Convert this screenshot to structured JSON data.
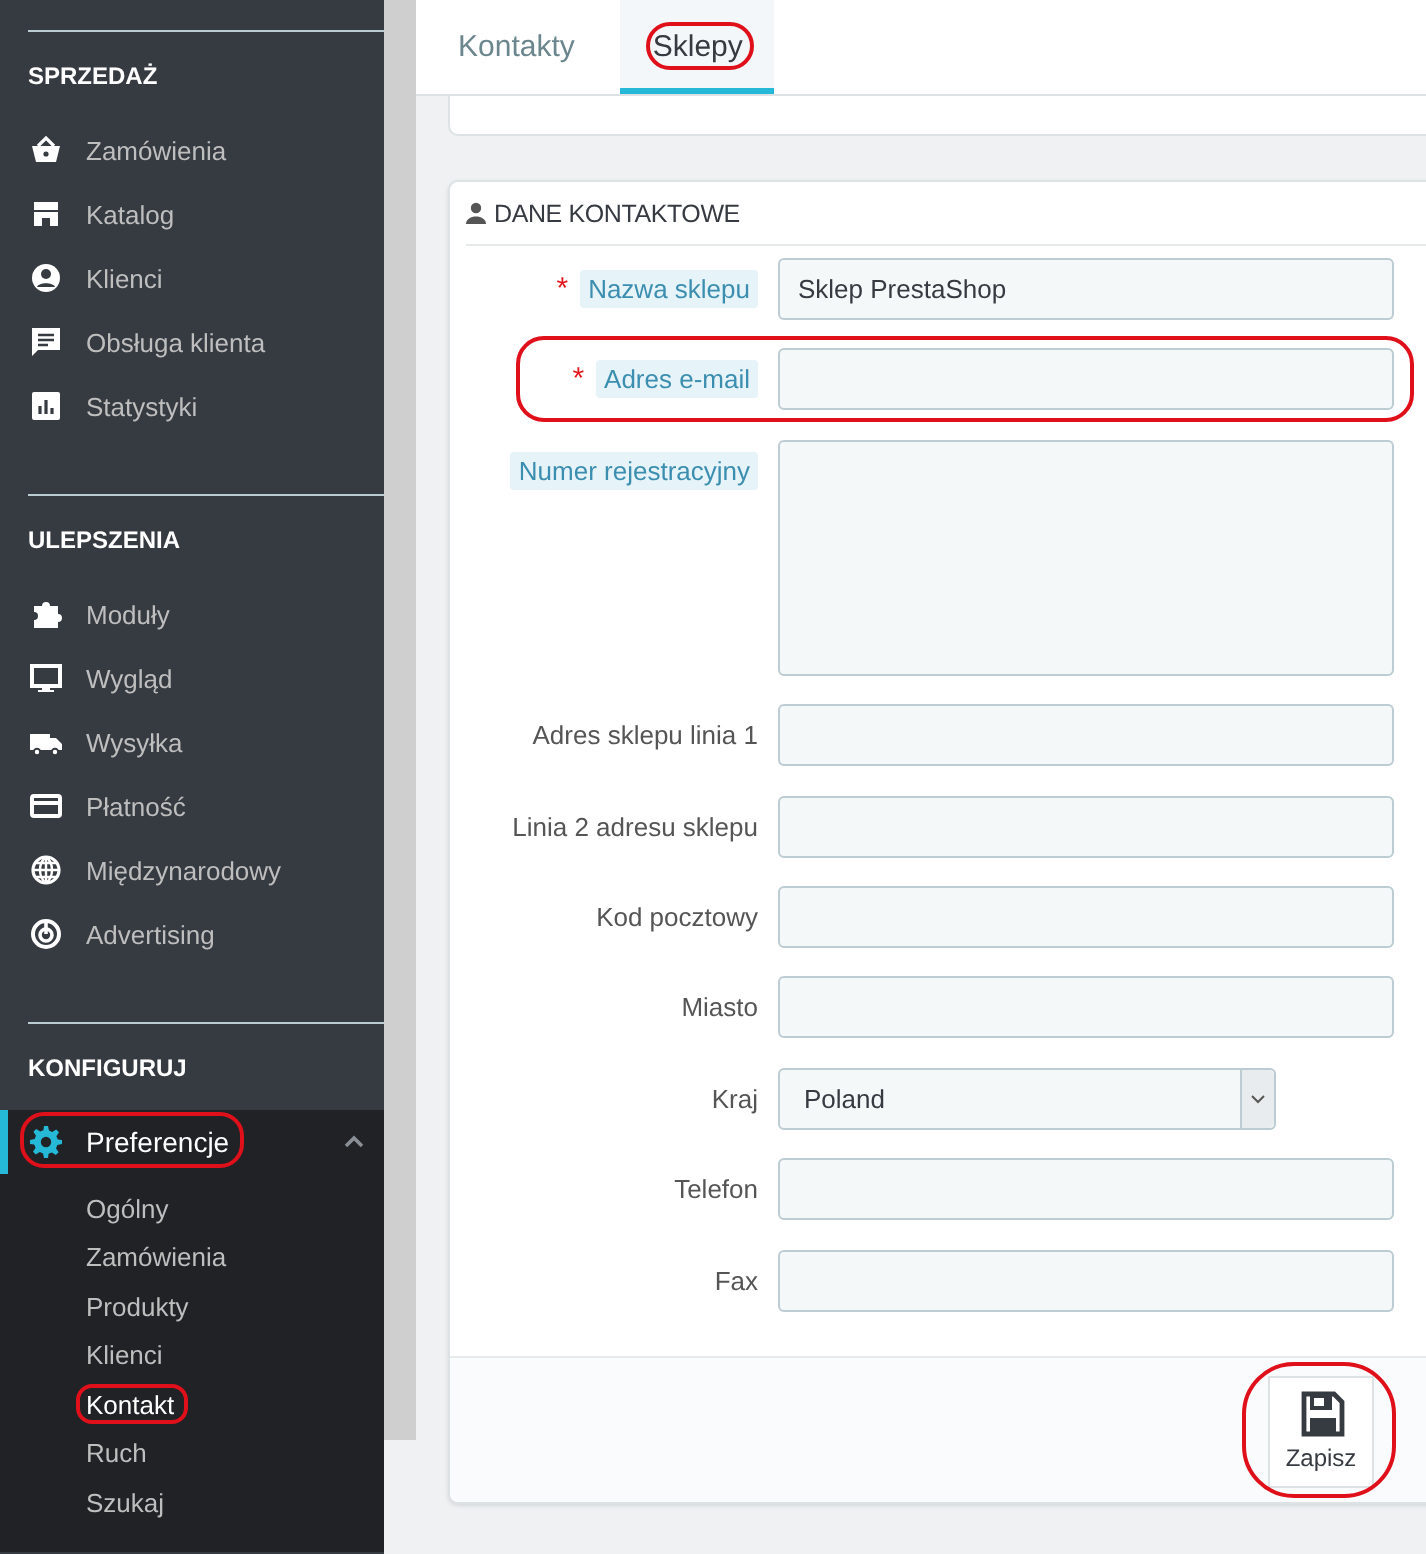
{
  "sidebar": {
    "sections": [
      {
        "title": "SPRZEDAŻ",
        "items": [
          {
            "label": "Zamówienia",
            "kind": "basket"
          },
          {
            "label": "Katalog",
            "kind": "store"
          },
          {
            "label": "Klienci",
            "kind": "person"
          },
          {
            "label": "Obsługa klienta",
            "kind": "chat"
          },
          {
            "label": "Statystyki",
            "kind": "chart"
          }
        ]
      },
      {
        "title": "ULEPSZENIA",
        "items": [
          {
            "label": "Moduły",
            "kind": "puzzle"
          },
          {
            "label": "Wygląd",
            "kind": "monitor"
          },
          {
            "label": "Wysyłka",
            "kind": "truck"
          },
          {
            "label": "Płatność",
            "kind": "card"
          },
          {
            "label": "Międzynarodowy",
            "kind": "globe"
          },
          {
            "label": "Advertising",
            "kind": "target"
          }
        ]
      },
      {
        "title": "KONFIGURUJ",
        "items": [
          {
            "label": "Preferencje",
            "kind": "gear",
            "selected": true,
            "expanded": true,
            "highlighted": true,
            "children": [
              {
                "label": "Ogólny",
                "selected": false,
                "highlighted": false
              },
              {
                "label": "Zamówienia",
                "selected": false,
                "highlighted": false
              },
              {
                "label": "Produkty",
                "selected": false,
                "highlighted": false
              },
              {
                "label": "Klienci",
                "selected": false,
                "highlighted": false
              },
              {
                "label": "Kontakt",
                "selected": true,
                "highlighted": true
              },
              {
                "label": "Ruch",
                "selected": false,
                "highlighted": false
              },
              {
                "label": "Szukaj",
                "selected": false,
                "highlighted": false
              }
            ]
          }
        ]
      }
    ]
  },
  "tabs": [
    {
      "label": "Kontakty",
      "selected": false,
      "highlighted": false
    },
    {
      "label": "Sklepy",
      "selected": true,
      "highlighted": true
    }
  ],
  "form": {
    "title": "DANE KONTAKTOWE",
    "fields": [
      {
        "label": "Nazwa sklepu",
        "kind": "text",
        "marker": "*",
        "hint": true,
        "value": "Sklep PrestaShop",
        "highlighted": false
      },
      {
        "label": "Adres e-mail",
        "kind": "text",
        "marker": "*",
        "hint": true,
        "highlighted": true
      },
      {
        "label": "Numer rejestracyjny",
        "kind": "textarea",
        "hint": true,
        "highlighted": false
      },
      {
        "label": "Adres sklepu linia 1",
        "kind": "text",
        "hint": false,
        "highlighted": false
      },
      {
        "label": "Linia 2 adresu sklepu",
        "kind": "text",
        "hint": false,
        "highlighted": false
      },
      {
        "label": "Kod pocztowy",
        "kind": "text",
        "hint": false,
        "highlighted": false
      },
      {
        "label": "Miasto",
        "kind": "text",
        "hint": false,
        "highlighted": false
      },
      {
        "label": "Kraj",
        "kind": "select",
        "hint": false,
        "value": "Poland",
        "highlighted": false
      },
      {
        "label": "Telefon",
        "kind": "text",
        "hint": false,
        "highlighted": false
      },
      {
        "label": "Fax",
        "kind": "text",
        "hint": false,
        "highlighted": false
      }
    ],
    "save_button": {
      "label": "Zapisz",
      "highlighted": true
    }
  }
}
